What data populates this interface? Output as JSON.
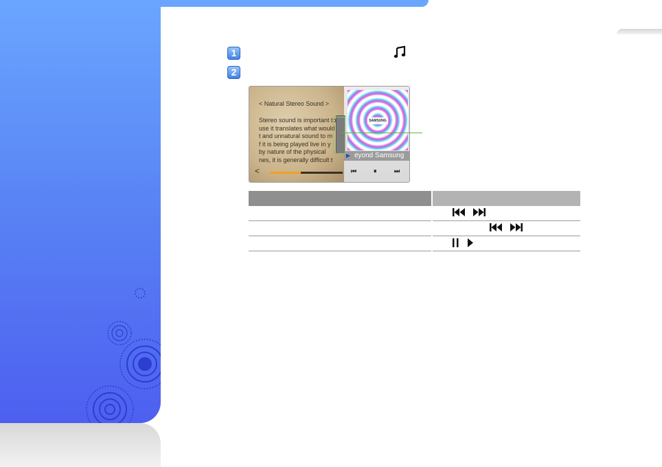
{
  "colors": {
    "sidebar_top": "#6aa6ff",
    "sidebar_bottom": "#4d5ff0",
    "badge": "#3d7fe0",
    "callout": "#5bb348",
    "table_header_left": "#8f8f8f",
    "table_header_right": "#b3b3b3"
  },
  "steps": [
    {
      "number": "1"
    },
    {
      "number": "2"
    }
  ],
  "step1_icon": "music-note-icon",
  "device": {
    "reader_title": "< Natural Stereo Sound >",
    "reader_lines": [
      "Stereo sound is important to",
      "use it translates what would",
      "t and unnatural sound to m",
      "f it is being played live in y",
      "by nature of the physical",
      "nes, it is generally difficult t"
    ],
    "reader_progress": 0.42,
    "back_arrow": "<",
    "album_logo": "SAMSUNG",
    "track_name": "eyond Samsung",
    "controls": [
      "prev-track-icon",
      "pause-icon",
      "next-track-icon"
    ]
  },
  "table": {
    "rows": [
      {
        "icons": [
          "skip-back-icon",
          "skip-forward-icon"
        ],
        "indent": 28
      },
      {
        "icons": [
          "skip-back-icon",
          "skip-forward-icon"
        ],
        "indent": 82
      },
      {
        "icons": [
          "pause-icon",
          "play-icon"
        ],
        "indent": 28
      }
    ]
  }
}
